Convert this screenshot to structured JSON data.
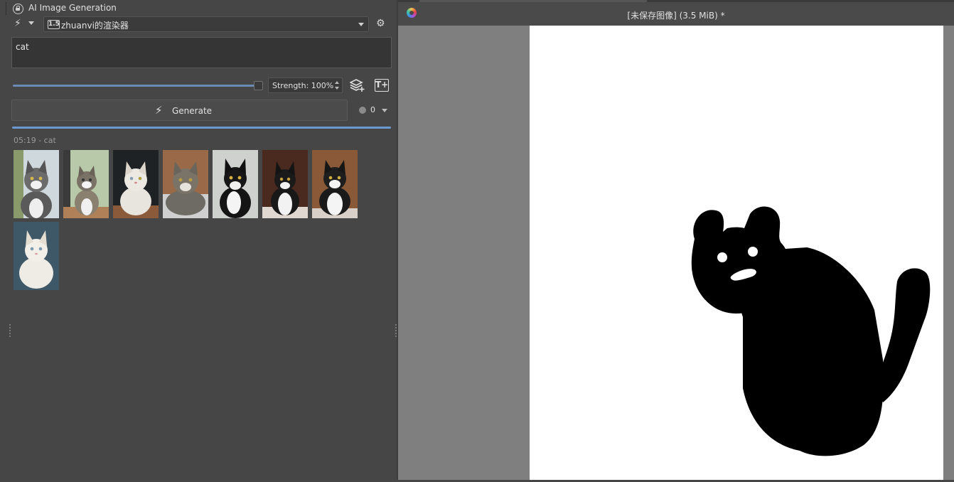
{
  "docker": {
    "title": "AI Image Generation",
    "model_badge": "1.5",
    "model_name": "zhuanvi的渲染器",
    "prompt": "cat",
    "strength_label": "Strength: 100%",
    "strength_value": 1.0,
    "generate_label": "Generate",
    "queue_count": "0",
    "progress": 1.0,
    "history_header": "05:19 - cat",
    "thumbnails": [
      {
        "name": "tabby cat by window"
      },
      {
        "name": "tabby cat on floor"
      },
      {
        "name": "white cat"
      },
      {
        "name": "tabby cat close-up"
      },
      {
        "name": "black and white cat"
      },
      {
        "name": "black and white cat sitting"
      },
      {
        "name": "black and white cat wooden background"
      },
      {
        "name": "white fluffy cat"
      }
    ]
  },
  "canvas": {
    "document_title": "[未保存图像]  (3.5 MiB) *",
    "drawing": "black cat doodle"
  },
  "colors": {
    "panel_bg": "#464646",
    "canvas_bg": "#7f7f7f",
    "accent": "#6a9ad0",
    "paper": "#ffffff"
  }
}
